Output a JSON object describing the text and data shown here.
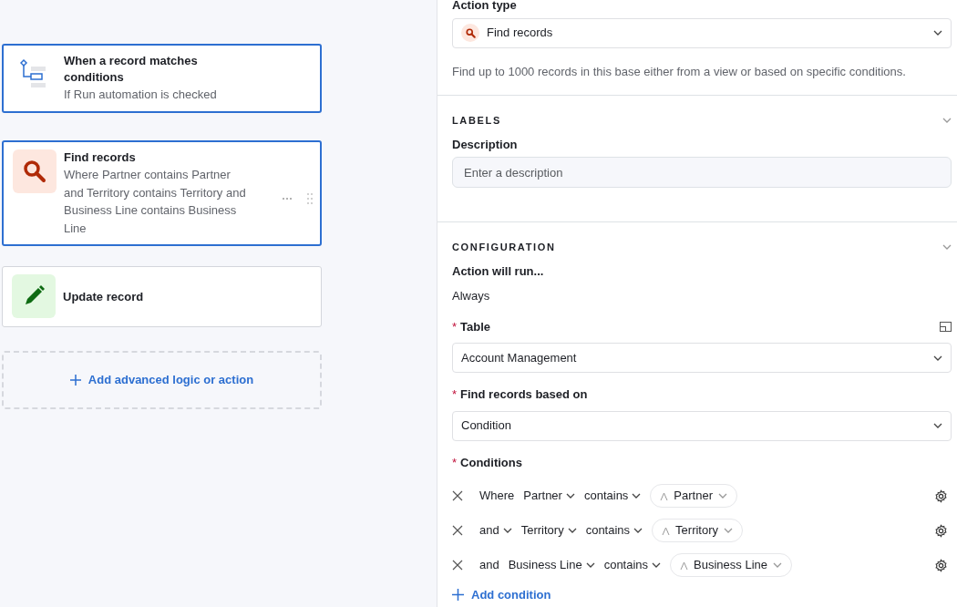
{
  "steps": [
    {
      "kind": "trigger",
      "title": "When a record matches conditions",
      "subtitle": "If Run automation is checked",
      "selected": true
    },
    {
      "kind": "search",
      "title": "Find records",
      "subtitle": "Where Partner contains Partner and Territory contains Territory and Business Line contains Business Line",
      "selected": true,
      "has_menu": true
    },
    {
      "kind": "edit",
      "title": "Update record",
      "selected": false
    }
  ],
  "add_step": {
    "label": "Add advanced logic or action"
  },
  "panel": {
    "action_type_label": "Action type",
    "action_type_value": "Find records",
    "action_help": "Find up to 1000 records in this base either from a view or based on specific conditions.",
    "labels_section": {
      "heading": "LABELS",
      "description_label": "Description",
      "description_placeholder": "Enter a description"
    },
    "configuration_section": {
      "heading": "CONFIGURATION",
      "run_label": "Action will run...",
      "run_value": "Always",
      "table_mark": "*",
      "table_label": "Table",
      "table_value": "Account Management",
      "basis_mark": "*",
      "basis_label": "Find records based on",
      "basis_value": "Condition",
      "conditions_mark": "*",
      "conditions_label": "Conditions",
      "conditions": [
        {
          "conjunction": "Where",
          "conjunction_dropdown": false,
          "field": "Partner",
          "operator": "contains",
          "value": "Partner"
        },
        {
          "conjunction": "and",
          "conjunction_dropdown": true,
          "field": "Territory",
          "operator": "contains",
          "value": "Territory"
        },
        {
          "conjunction": "and",
          "conjunction_dropdown": false,
          "field": "Business Line",
          "operator": "contains",
          "value": "Business Line"
        }
      ],
      "add_condition": "Add condition"
    }
  }
}
